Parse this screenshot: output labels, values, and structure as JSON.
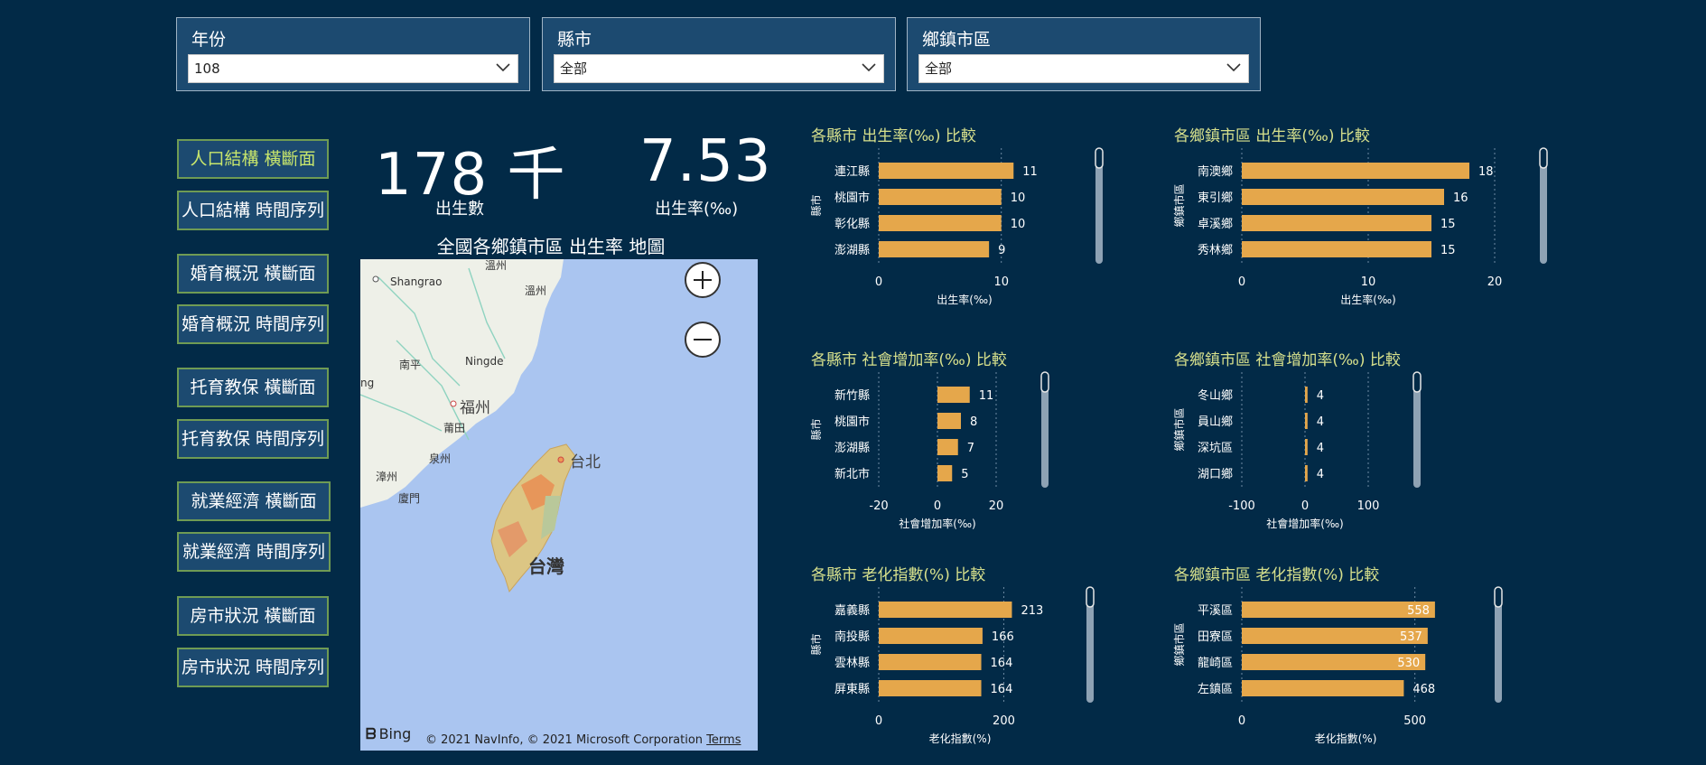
{
  "slicers": [
    {
      "label": "年份",
      "value": "108"
    },
    {
      "label": "縣市",
      "value": "全部"
    },
    {
      "label": "鄉鎮市區",
      "value": "全部"
    }
  ],
  "nav": [
    {
      "label": "人口結構 橫斷面",
      "active": true
    },
    {
      "label": "人口結構 時間序列"
    },
    {
      "label": "婚育概況 橫斷面"
    },
    {
      "label": "婚育概況 時間序列"
    },
    {
      "label": "托育教保 橫斷面"
    },
    {
      "label": "托育教保 時間序列"
    },
    {
      "label": "就業經濟 橫斷面"
    },
    {
      "label": "就業經濟 時間序列"
    },
    {
      "label": "房市狀況 橫斷面"
    },
    {
      "label": "房市狀況 時間序列"
    }
  ],
  "kpis": [
    {
      "value": "178 千",
      "label": "出生數"
    },
    {
      "value": "7.53",
      "label": "出生率(‰)"
    }
  ],
  "map": {
    "title": "全國各鄉鎮市區 出生率 地圖",
    "labels": {
      "l1": "Shangrao",
      "l2": "溫州",
      "l3": "南平",
      "l4": "Ningde",
      "l5": "福州",
      "l6": "莆田",
      "l7": "泉州",
      "l8": "漳州",
      "l9": "廈門",
      "l10": "台北",
      "l11": "台灣",
      "l12": "ng",
      "l13": "溫州"
    },
    "bing": "Bing",
    "attribution": "© 2021 NavInfo, © 2021 Microsoft Corporation",
    "terms": "Terms",
    "zoom_in_icon": "plus-icon",
    "zoom_out_icon": "minus-icon"
  },
  "chart_data": [
    {
      "type": "bar",
      "title": "各縣市 出生率(‰) 比較",
      "ylabel": "縣市",
      "xlabel": "出生率(‰)",
      "categories": [
        "連江縣",
        "桃園市",
        "彰化縣",
        "澎湖縣"
      ],
      "values": [
        11,
        10,
        10,
        9
      ],
      "xlim": [
        0,
        14
      ],
      "ticks": [
        0,
        10
      ],
      "label_inside": false
    },
    {
      "type": "bar",
      "title": "各鄉鎮市區 出生率(‰) 比較",
      "ylabel": "鄉鎮市區",
      "xlabel": "出生率(‰)",
      "categories": [
        "南澳鄉",
        "東引鄉",
        "卓溪鄉",
        "秀林鄉"
      ],
      "values": [
        18,
        16,
        15,
        15
      ],
      "xlim": [
        0,
        20
      ],
      "ticks": [
        0,
        10,
        20
      ],
      "label_inside": false
    },
    {
      "type": "bar",
      "title": "各縣市 社會增加率(‰) 比較",
      "ylabel": "縣市",
      "xlabel": "社會增加率(‰)",
      "categories": [
        "新竹縣",
        "桃園市",
        "澎湖縣",
        "新北市"
      ],
      "values": [
        11,
        8,
        7,
        5
      ],
      "xlim": [
        -20,
        20
      ],
      "ticks": [
        -20,
        0,
        20
      ],
      "label_inside": false
    },
    {
      "type": "bar",
      "title": "各鄉鎮市區 社會增加率(‰) 比較",
      "ylabel": "鄉鎮市區",
      "xlabel": "社會增加率(‰)",
      "categories": [
        "冬山鄉",
        "員山鄉",
        "深坑區",
        "湖口鄉"
      ],
      "values": [
        4,
        4,
        4,
        4
      ],
      "xlim": [
        -100,
        100
      ],
      "ticks": [
        -100,
        0,
        100
      ],
      "label_inside": false
    },
    {
      "type": "bar",
      "title": "各縣市 老化指數(%) 比較",
      "ylabel": "縣市",
      "xlabel": "老化指數(%)",
      "categories": [
        "嘉義縣",
        "南投縣",
        "雲林縣",
        "屏東縣"
      ],
      "values": [
        213,
        166,
        164,
        164
      ],
      "xlim": [
        0,
        260
      ],
      "ticks": [
        0,
        200
      ],
      "label_inside": false
    },
    {
      "type": "bar",
      "title": "各鄉鎮市區 老化指數(%) 比較",
      "ylabel": "鄉鎮市區",
      "xlabel": "老化指數(%)",
      "categories": [
        "平溪區",
        "田寮區",
        "龍崎區",
        "左鎮區"
      ],
      "values": [
        558,
        537,
        530,
        468
      ],
      "xlim": [
        0,
        600
      ],
      "ticks": [
        0,
        500
      ],
      "label_inside": [
        true,
        true,
        true,
        false
      ]
    }
  ],
  "colors": {
    "background": "#022a47",
    "bar": "#e5a74b",
    "title": "#d7e08c",
    "nav_active": "#c8e66c",
    "nav_border": "#6f9b54"
  }
}
